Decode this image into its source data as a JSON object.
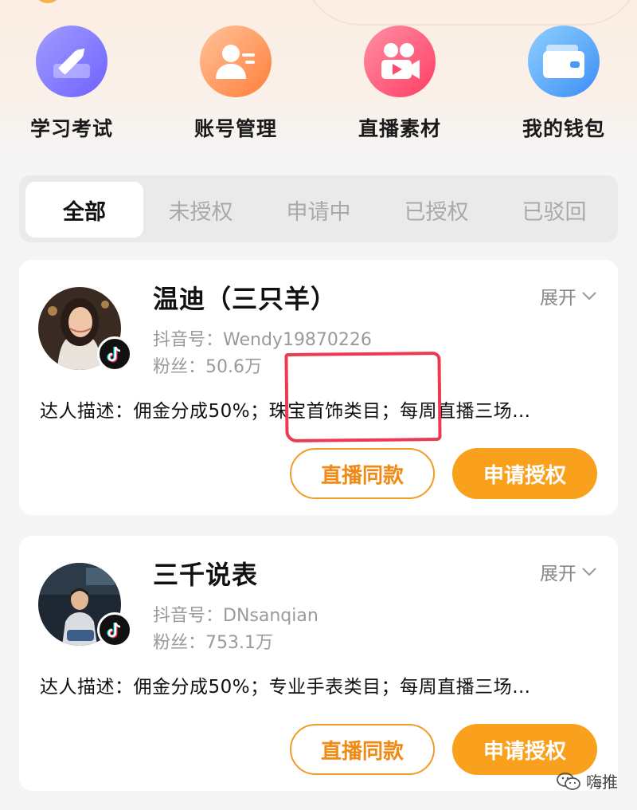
{
  "quick_menu": [
    {
      "label": "学习考试",
      "icon": "pencil-icon"
    },
    {
      "label": "账号管理",
      "icon": "account-icon"
    },
    {
      "label": "直播素材",
      "icon": "video-camera-icon"
    },
    {
      "label": "我的钱包",
      "icon": "wallet-icon"
    }
  ],
  "tabs": [
    "全部",
    "未授权",
    "申请中",
    "已授权",
    "已驳回"
  ],
  "active_tab": "全部",
  "cards": [
    {
      "name": "温迪（三只羊）",
      "douyin_label": "抖音号：",
      "douyin_id": "Wendy19870226",
      "fans_label": "粉丝：",
      "fans": "50.6万",
      "expand": "展开",
      "desc_label": "达人描述：",
      "desc": "佣金分成50%；珠宝首饰类目；每周直播三场…",
      "btn_same": "直播同款",
      "btn_apply": "申请授权"
    },
    {
      "name": "三千说表",
      "douyin_label": "抖音号：",
      "douyin_id": "DNsanqian",
      "fans_label": "粉丝：",
      "fans": "753.1万",
      "expand": "展开",
      "desc_label": "达人描述：",
      "desc": "佣金分成50%；专业手表类目；每周直播三场…",
      "btn_same": "直播同款",
      "btn_apply": "申请授权"
    }
  ],
  "watermark": "嗨推",
  "colors": {
    "accent": "#f9a01c",
    "highlight": "#ec3a4f"
  }
}
